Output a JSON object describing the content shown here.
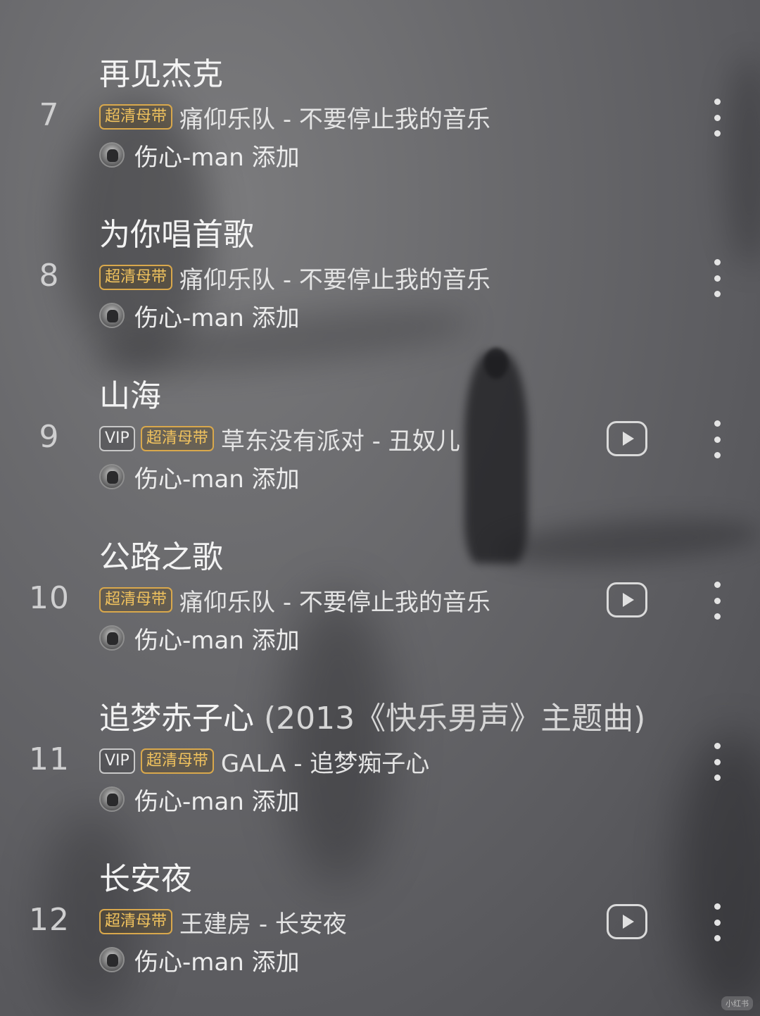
{
  "tracks": [
    {
      "number": "7",
      "title": "再见杰克",
      "title_suffix": "",
      "badges": [
        "超清母带"
      ],
      "artist_album": "痛仰乐队 - 不要停止我的音乐",
      "added_by": "伤心-man 添加",
      "has_mv": false
    },
    {
      "number": "8",
      "title": "为你唱首歌",
      "title_suffix": "",
      "badges": [
        "超清母带"
      ],
      "artist_album": "痛仰乐队 - 不要停止我的音乐",
      "added_by": "伤心-man 添加",
      "has_mv": false
    },
    {
      "number": "9",
      "title": "山海",
      "title_suffix": "",
      "badges": [
        "VIP",
        "超清母带"
      ],
      "artist_album": "草东没有派对 - 丑奴儿",
      "added_by": "伤心-man 添加",
      "has_mv": true
    },
    {
      "number": "10",
      "title": "公路之歌",
      "title_suffix": "",
      "badges": [
        "超清母带"
      ],
      "artist_album": "痛仰乐队 - 不要停止我的音乐",
      "added_by": "伤心-man 添加",
      "has_mv": true
    },
    {
      "number": "11",
      "title": "追梦赤子心",
      "title_suffix": " (2013《快乐男声》主题曲)",
      "badges": [
        "VIP",
        "超清母带"
      ],
      "artist_album": "GALA - 追梦痴子心",
      "added_by": "伤心-man 添加",
      "has_mv": false
    },
    {
      "number": "12",
      "title": "长安夜",
      "title_suffix": "",
      "badges": [
        "超清母带"
      ],
      "artist_album": "王建房 - 长安夜",
      "added_by": "伤心-man 添加",
      "has_mv": true
    }
  ],
  "watermark": "小红书",
  "colors": {
    "hq_badge": "#f0c25e",
    "text": "#ededed"
  }
}
